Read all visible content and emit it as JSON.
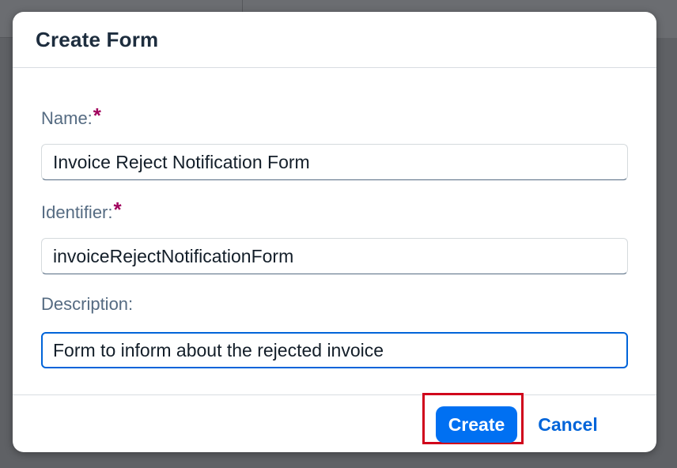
{
  "dialog": {
    "title": "Create Form",
    "fields": [
      {
        "label": "Name:",
        "required_marker": "*",
        "value": "Invoice Reject Notification Form"
      },
      {
        "label": "Identifier:",
        "required_marker": "*",
        "value": "invoiceRejectNotificationForm"
      },
      {
        "label": "Description:",
        "value": "Form to inform about the rejected invoice"
      }
    ],
    "footer": {
      "create_label": "Create",
      "cancel_label": "Cancel"
    }
  },
  "colors": {
    "accent": "#0070f2",
    "link": "#0064d9",
    "required": "#a1005d",
    "highlight": "#d0021b",
    "overlay": "#5f6165"
  }
}
